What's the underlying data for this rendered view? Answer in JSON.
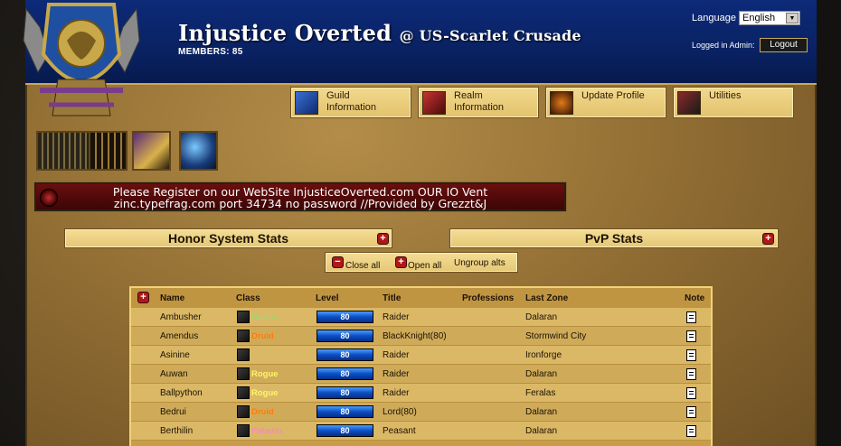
{
  "header": {
    "guild_name": "Injustice Overted",
    "realm": "@ US-Scarlet Crusade",
    "members": "MEMBERS: 85",
    "language_label": "Language",
    "language_value": "English",
    "admin_label": "Logged in Admin:",
    "logout_label": "Logout"
  },
  "nav": [
    {
      "line1": "Guild",
      "line2": "Information",
      "icon": "guild-icon"
    },
    {
      "line1": "Realm",
      "line2": "Information",
      "icon": "realm-icon"
    },
    {
      "line1": "Update Profile",
      "line2": "",
      "icon": "profile-icon"
    },
    {
      "line1": "Utilities",
      "line2": "",
      "icon": "utilities-icon"
    }
  ],
  "banner": {
    "line1": "Please Register on our WebSite InjusticeOverted.com OUR IO Vent",
    "line2": "zinc.typefrag.com port 34734 no password  //Provided by Grezzt&J"
  },
  "stats": {
    "honor_label": "Honor System Stats",
    "pvp_label": "PvP Stats"
  },
  "controls": {
    "close_all": "Close all",
    "open_all": "Open all",
    "ungroup": "Ungroup alts"
  },
  "roster": {
    "headers": {
      "name": "Name",
      "class": "Class",
      "level": "Level",
      "title": "Title",
      "professions": "Professions",
      "zone": "Last Zone",
      "note": "Note"
    },
    "rows": [
      {
        "name": "Ambusher",
        "class": "Hunter",
        "class_color": "#a9d271",
        "level": "80",
        "title": "Raider",
        "zone": "Dalaran"
      },
      {
        "name": "Amendus",
        "class": "Druid",
        "class_color": "#ff7d0a",
        "level": "80",
        "title": "BlackKnight(80)",
        "zone": "Stormwind City"
      },
      {
        "name": "Asinine",
        "class": "",
        "class_color": "#ffffff",
        "level": "80",
        "title": "Raider",
        "zone": "Ironforge"
      },
      {
        "name": "Auwan",
        "class": "Rogue",
        "class_color": "#fff569",
        "level": "80",
        "title": "Raider",
        "zone": "Dalaran"
      },
      {
        "name": "Ballpython",
        "class": "Rogue",
        "class_color": "#fff569",
        "level": "80",
        "title": "Raider",
        "zone": "Feralas"
      },
      {
        "name": "Bedrui",
        "class": "Druid",
        "class_color": "#ff7d0a",
        "level": "80",
        "title": "Lord(80)",
        "zone": "Dalaran"
      },
      {
        "name": "Berthilin",
        "class": "Paladin",
        "class_color": "#f58cba",
        "level": "80",
        "title": "Peasant",
        "zone": "Dalaran"
      }
    ]
  }
}
